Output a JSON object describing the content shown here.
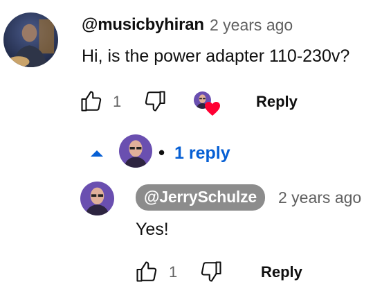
{
  "comment": {
    "author": "@musicbyhiran",
    "time": "2 years ago",
    "text": "Hi, is the power adapter 110-230v?",
    "like_count": "1",
    "reply_label": "Reply",
    "icons": {
      "like": "thumbs-up-icon",
      "dislike": "thumbs-down-icon",
      "creator_heart": "heart-icon"
    }
  },
  "replies_toggle": {
    "label": "1 reply",
    "separator": "•",
    "icon": "caret-up-icon"
  },
  "reply": {
    "author": "@JerrySchulze",
    "time": "2 years ago",
    "text": "Yes!",
    "like_count": "1",
    "reply_label": "Reply"
  },
  "colors": {
    "link_blue": "#065fd4",
    "heart_red": "#ff0033",
    "pill_gray": "#8c8c8c",
    "muted_text": "#606060"
  }
}
